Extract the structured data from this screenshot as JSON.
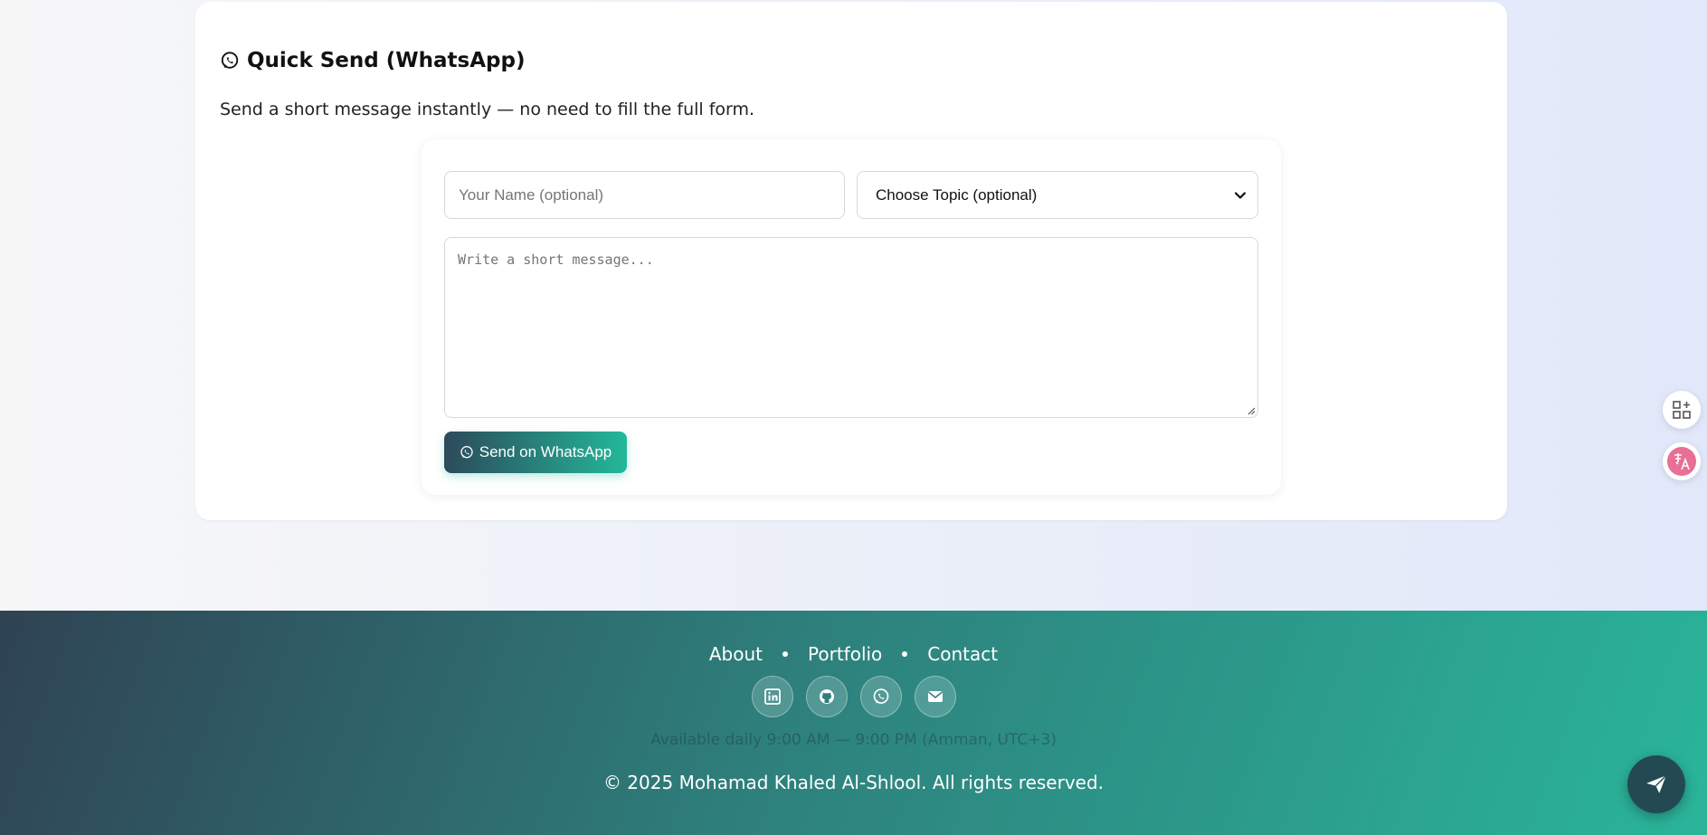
{
  "quick_send": {
    "title": "Quick Send (WhatsApp)",
    "description": "Send a short message instantly — no need to fill the full form.",
    "name_placeholder": "Your Name (optional)",
    "topic_selected": "Choose Topic (optional)",
    "message_placeholder": "Write a short message...",
    "send_label": "Send on WhatsApp"
  },
  "footer": {
    "nav": [
      "About",
      "Portfolio",
      "Contact"
    ],
    "socials": [
      "linkedin-icon",
      "github-icon",
      "whatsapp-icon",
      "envelope-icon"
    ],
    "hours": "Available daily 9:00 AM — 9:00 PM (Amman, UTC+3)",
    "copyright": "© 2025 Mohamad Khaled Al-Shlool. All rights reserved."
  },
  "colors": {
    "accent_start": "#2c4a5a",
    "accent_end": "#23b89a",
    "translate_badge": "#e86f95"
  }
}
